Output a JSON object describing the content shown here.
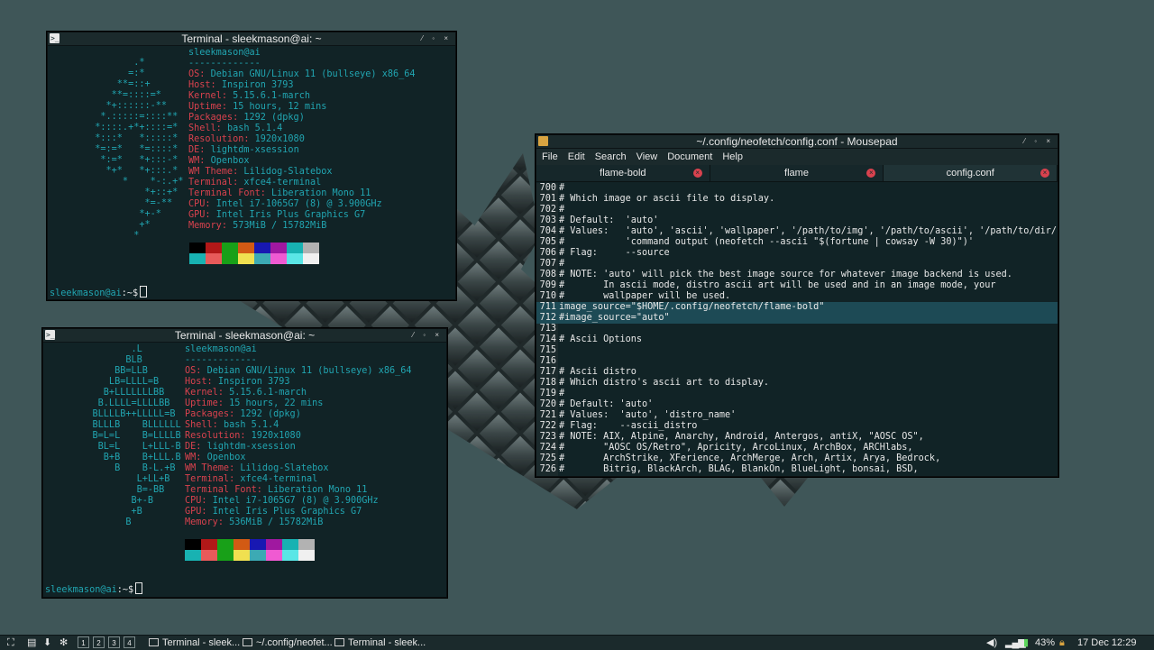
{
  "desktop": {
    "background": "#3f5658"
  },
  "terminal1": {
    "title": "Terminal - sleekmason@ai: ~",
    "ascii": [
      "         .*",
      "        =:*",
      "      **=::+",
      "     **=::::=*",
      "    *+::::::-**",
      "   *.:::::=::::**",
      "  *::::.+*+::::=*",
      "  *:::*   *:::::*",
      "  *=:=*   *=::::*",
      "   *:=*   *+:::-*",
      "    *+*   *+:::.*",
      "       *    *-:.+*",
      "           *+::+*",
      "           *=-**",
      "          *+-*",
      "          +*",
      "         *"
    ],
    "user_host": "sleekmason@ai",
    "separator": "-------------",
    "info": [
      {
        "key": "OS",
        "value": "Debian GNU/Linux 11 (bullseye) x86_64"
      },
      {
        "key": "Host",
        "value": "Inspiron 3793"
      },
      {
        "key": "Kernel",
        "value": "5.15.6.1-march"
      },
      {
        "key": "Uptime",
        "value": "15 hours, 12 mins"
      },
      {
        "key": "Packages",
        "value": "1292 (dpkg)"
      },
      {
        "key": "Shell",
        "value": "bash 5.1.4"
      },
      {
        "key": "Resolution",
        "value": "1920x1080"
      },
      {
        "key": "DE",
        "value": "lightdm-xsession"
      },
      {
        "key": "WM",
        "value": "Openbox"
      },
      {
        "key": "WM Theme",
        "value": "Lilidog-Slatebox"
      },
      {
        "key": "Terminal",
        "value": "xfce4-terminal"
      },
      {
        "key": "Terminal Font",
        "value": "Liberation Mono 11"
      },
      {
        "key": "CPU",
        "value": "Intel i7-1065G7 (8) @ 3.900GHz"
      },
      {
        "key": "GPU",
        "value": "Intel Iris Plus Graphics G7"
      },
      {
        "key": "Memory",
        "value": "573MiB / 15782MiB"
      }
    ],
    "prompt_user": "sleekmason@ai",
    "prompt_tail": ":~$"
  },
  "terminal2": {
    "title": "Terminal - sleekmason@ai: ~",
    "ascii": [
      "",
      "           .L",
      "          BLB",
      "        BB=LLB",
      "       LB=LLLL=B",
      "      B+LLLLLLLBB",
      "     B.LLLL=LLLLBB",
      "    BLLLLB++LLLLL=B",
      "    BLLLB    BLLLLLL",
      "    B=L=L    B=LLLLB",
      "     BL=L    L+LLL-B",
      "      B+B    B+LLL.B",
      "        B    B-L.+B",
      "            L+LL+B",
      "            B=-BB",
      "           B+-B",
      "           +B",
      "          B"
    ],
    "user_host": "sleekmason@ai",
    "separator": "-------------",
    "info": [
      {
        "key": "OS",
        "value": "Debian GNU/Linux 11 (bullseye) x86_64"
      },
      {
        "key": "Host",
        "value": "Inspiron 3793"
      },
      {
        "key": "Kernel",
        "value": "5.15.6.1-march"
      },
      {
        "key": "Uptime",
        "value": "15 hours, 22 mins"
      },
      {
        "key": "Packages",
        "value": "1292 (dpkg)"
      },
      {
        "key": "Shell",
        "value": "bash 5.1.4"
      },
      {
        "key": "Resolution",
        "value": "1920x1080"
      },
      {
        "key": "DE",
        "value": "lightdm-xsession"
      },
      {
        "key": "WM",
        "value": "Openbox"
      },
      {
        "key": "WM Theme",
        "value": "Lilidog-Slatebox"
      },
      {
        "key": "Terminal",
        "value": "xfce4-terminal"
      },
      {
        "key": "Terminal Font",
        "value": "Liberation Mono 11"
      },
      {
        "key": "CPU",
        "value": "Intel i7-1065G7 (8) @ 3.900GHz"
      },
      {
        "key": "GPU",
        "value": "Intel Iris Plus Graphics G7"
      },
      {
        "key": "Memory",
        "value": "536MiB / 15782MiB"
      }
    ],
    "prompt_user": "sleekmason@ai",
    "prompt_tail": ":~$"
  },
  "swatch_colors": {
    "row1": [
      "#000000",
      "#b21818",
      "#18a018",
      "#d25a14",
      "#1818b2",
      "#a018a0",
      "#18b2b2",
      "#b2b2b2"
    ],
    "row2": [
      "#18b2b2",
      "#e85a5a",
      "#18a018",
      "#f0e050",
      "#3caab4",
      "#f05ad2",
      "#5ae6e6",
      "#f0f0f0"
    ]
  },
  "mousepad": {
    "title": "~/.config/neofetch/config.conf - Mousepad",
    "menu": [
      "File",
      "Edit",
      "Search",
      "View",
      "Document",
      "Help"
    ],
    "tabs": [
      {
        "label": "flame-bold",
        "active": false
      },
      {
        "label": "flame",
        "active": false
      },
      {
        "label": "config.conf",
        "active": true
      }
    ],
    "lines": [
      {
        "n": "700",
        "text": "#"
      },
      {
        "n": "701",
        "text": "# Which image or ascii file to display."
      },
      {
        "n": "702",
        "text": "#"
      },
      {
        "n": "703",
        "text": "# Default:  'auto'"
      },
      {
        "n": "704",
        "text": "# Values:   'auto', 'ascii', 'wallpaper', '/path/to/img', '/path/to/ascii', '/path/to/dir/'"
      },
      {
        "n": "705",
        "text": "#           'command output (neofetch --ascii \"$(fortune | cowsay -W 30)\")'"
      },
      {
        "n": "706",
        "text": "# Flag:     --source"
      },
      {
        "n": "707",
        "text": "#"
      },
      {
        "n": "708",
        "text": "# NOTE: 'auto' will pick the best image source for whatever image backend is used."
      },
      {
        "n": "709",
        "text": "#       In ascii mode, distro ascii art will be used and in an image mode, your"
      },
      {
        "n": "710",
        "text": "#       wallpaper will be used."
      },
      {
        "n": "711",
        "text": "image_source=\"$HOME/.config/neofetch/flame-bold\""
      },
      {
        "n": "712",
        "text": "#image_source=\"auto\""
      },
      {
        "n": "713",
        "text": ""
      },
      {
        "n": "714",
        "text": "# Ascii Options"
      },
      {
        "n": "715",
        "text": ""
      },
      {
        "n": "716",
        "text": ""
      },
      {
        "n": "717",
        "text": "# Ascii distro"
      },
      {
        "n": "718",
        "text": "# Which distro's ascii art to display."
      },
      {
        "n": "719",
        "text": "#"
      },
      {
        "n": "720",
        "text": "# Default: 'auto'"
      },
      {
        "n": "721",
        "text": "# Values:  'auto', 'distro_name'"
      },
      {
        "n": "722",
        "text": "# Flag:    --ascii_distro"
      },
      {
        "n": "723",
        "text": "# NOTE: AIX, Alpine, Anarchy, Android, Antergos, antiX, \"AOSC OS\","
      },
      {
        "n": "724",
        "text": "#       \"AOSC OS/Retro\", Apricity, ArcoLinux, ArchBox, ARCHlabs,"
      },
      {
        "n": "725",
        "text": "#       ArchStrike, XFerience, ArchMerge, Arch, Artix, Arya, Bedrock,"
      },
      {
        "n": "726",
        "text": "#       Bitrig, BlackArch, BLAG, BlankOn, BlueLight, bonsai, BSD,"
      }
    ],
    "highlighted": [
      "711",
      "712"
    ]
  },
  "taskbar": {
    "workspaces": [
      "1",
      "2",
      "3",
      "4"
    ],
    "tasks": [
      {
        "label": "Terminal - sleek..."
      },
      {
        "label": "~/.config/neofet..."
      },
      {
        "label": "Terminal - sleek..."
      }
    ],
    "battery": "43%",
    "clock": "17 Dec 12:29"
  }
}
